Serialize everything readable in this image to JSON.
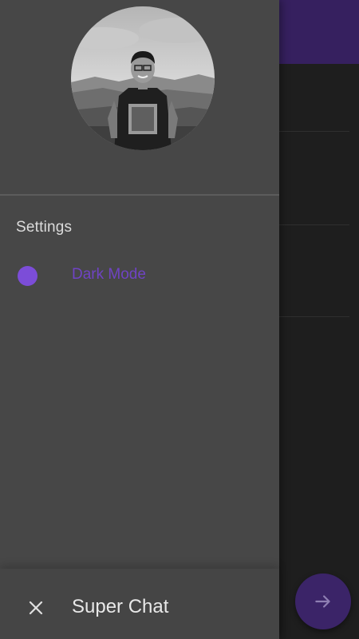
{
  "drawer": {
    "avatar_alt": "profile photo",
    "section_title": "Settings",
    "settings": [
      {
        "label": "Dark Mode",
        "icon": "toggle-dot-icon",
        "state": "on"
      }
    ],
    "footer": {
      "close_icon": "close-icon",
      "title": "Super Chat"
    }
  },
  "fab": {
    "icon": "arrow-right-icon"
  },
  "colors": {
    "accent": "#7c4dd8",
    "accent_text": "#6f43c4",
    "appbar": "#36205f",
    "fab": "#3b2468",
    "drawer_bg": "#474747",
    "background": "#1e1e1e"
  }
}
